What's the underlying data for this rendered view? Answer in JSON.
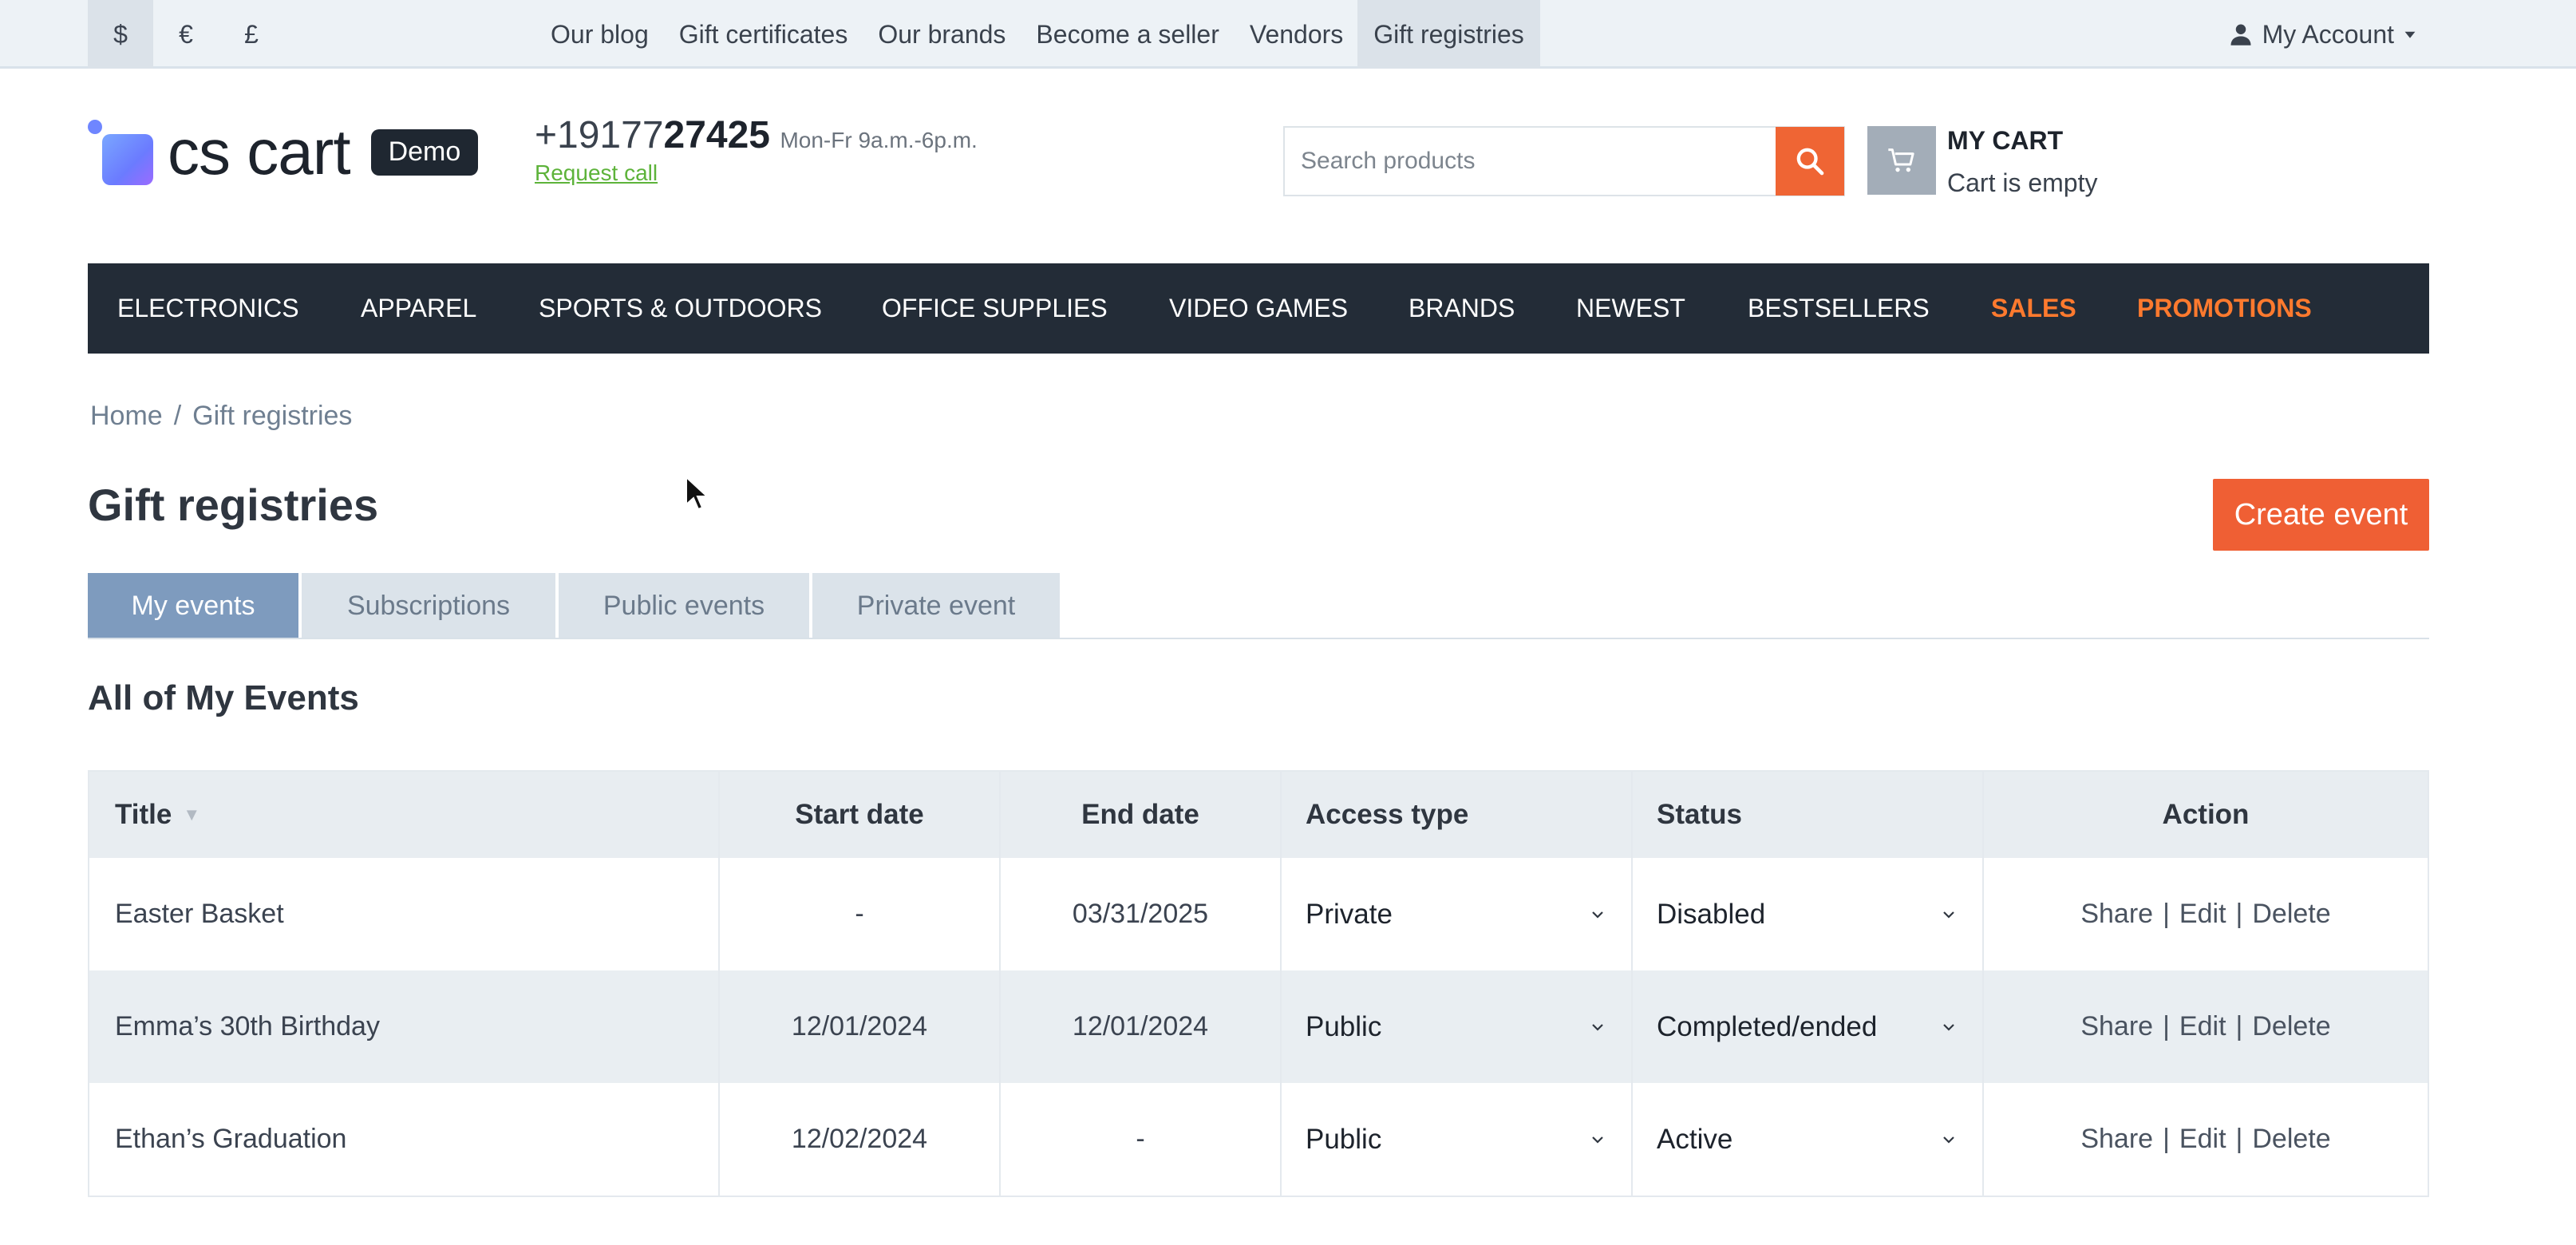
{
  "topbar": {
    "currencies": [
      "$",
      "€",
      "£"
    ],
    "links": [
      "Our blog",
      "Gift certificates",
      "Our brands",
      "Become a seller",
      "Vendors",
      "Gift registries"
    ],
    "account": "My Account",
    "account_icon": "user-icon"
  },
  "header": {
    "logo_text": "cs cart",
    "demo_badge": "Demo",
    "phone_prefix": "+19177",
    "phone_bold": "27425",
    "hours": "Mon-Fr 9a.m.-6p.m.",
    "request_call": "Request call",
    "search_placeholder": "Search products",
    "cart_title": "MY CART",
    "cart_status": "Cart is empty"
  },
  "nav": [
    "ELECTRONICS",
    "APPAREL",
    "SPORTS & OUTDOORS",
    "OFFICE SUPPLIES",
    "VIDEO GAMES",
    "BRANDS",
    "NEWEST",
    "BESTSELLERS",
    "SALES",
    "PROMOTIONS"
  ],
  "breadcrumb": {
    "home": "Home",
    "separator": "/",
    "current": "Gift registries"
  },
  "page": {
    "title": "Gift registries",
    "create_button": "Create event",
    "tabs": [
      "My events",
      "Subscriptions",
      "Public events",
      "Private event"
    ],
    "section_title": "All of My Events"
  },
  "table": {
    "headers": [
      "Title",
      "Start date",
      "End date",
      "Access type",
      "Status",
      "Action"
    ],
    "rows": [
      {
        "title": "Easter Basket",
        "start": "-",
        "end": "03/31/2025",
        "access": "Private",
        "status": "Disabled"
      },
      {
        "title": "Emma’s 30th Birthday",
        "start": "12/01/2024",
        "end": "12/01/2024",
        "access": "Public",
        "status": "Completed/ended"
      },
      {
        "title": "Ethan’s Graduation",
        "start": "12/02/2024",
        "end": "-",
        "access": "Public",
        "status": "Active"
      }
    ],
    "actions": {
      "share": "Share",
      "edit": "Edit",
      "delete": "Delete",
      "separator": "|"
    }
  },
  "colors": {
    "accent": "#ef6534",
    "nav_bg": "#232c37",
    "tab_active": "#7e9bbe",
    "hot": "#ff7a2e"
  }
}
